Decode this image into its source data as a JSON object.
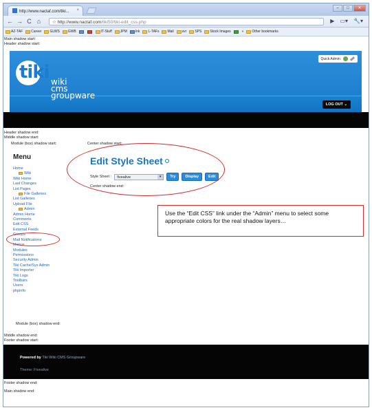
{
  "browser": {
    "tab_title": "http://www.nactaf.com/tiki...",
    "tab_close": "×",
    "window_controls": [
      "–",
      "□",
      "✕"
    ],
    "url_host": "http://www.nactaf.com",
    "url_path": "/tiki50/tiki-edit_css.php",
    "bookmarks": [
      {
        "label": "AZ-TAF",
        "icon": "folder"
      },
      {
        "label": "Career",
        "icon": "folder"
      },
      {
        "label": "GLWS",
        "icon": "folder"
      },
      {
        "label": "GWB",
        "icon": "folder"
      },
      {
        "label": "",
        "icon": "app"
      },
      {
        "label": "",
        "icon": "gmail"
      },
      {
        "label": "IT-Stuff",
        "icon": "folder"
      },
      {
        "label": "JPM",
        "icon": "folder"
      },
      {
        "label": "Ink",
        "icon": "app"
      },
      {
        "label": "L-TAFs",
        "icon": "folder"
      },
      {
        "label": "Mail",
        "icon": "folder"
      },
      {
        "label": "svr",
        "icon": "folder"
      },
      {
        "label": "SPS",
        "icon": "folder"
      },
      {
        "label": "Stock Images",
        "icon": "folder"
      },
      {
        "label": "",
        "icon": "green"
      },
      {
        "label": "»",
        "icon": ""
      },
      {
        "label": "Other bookmarks",
        "icon": "folder"
      }
    ]
  },
  "debug": {
    "main_start": "Main shadow start:",
    "header_start": "Header shadow start:",
    "header_end": "Header shadow end:",
    "middle_start": "Middle shadow start:",
    "module_start": "Module (box) shadow start:",
    "center_start": "Center shadow start:",
    "center_end": "Center shadow end:",
    "module_end": "Module (box) shadow end:",
    "middle_end": "Middle shadow end:",
    "footer_start": "Footer shadow start:",
    "footer_end": "Footer shadow end:",
    "main_end": "Main shadow end:"
  },
  "header": {
    "logo_main": "tiki",
    "logo_words": [
      "wiki",
      "cms",
      "groupware"
    ],
    "quick_admin": "Quick Admin:",
    "logout": "LOG OUT"
  },
  "menu": {
    "title": "Menu",
    "items": [
      {
        "label": "Home",
        "sub": false
      },
      {
        "label": "Wiki",
        "sub": true
      },
      {
        "label": "Wiki Home",
        "sub": false
      },
      {
        "label": "Last Changes",
        "sub": false
      },
      {
        "label": "List Pages",
        "sub": false
      },
      {
        "label": "File Galleries",
        "sub": true
      },
      {
        "label": "List Galleries",
        "sub": false
      },
      {
        "label": "Upload File",
        "sub": false
      },
      {
        "label": "Admin",
        "sub": true
      },
      {
        "label": "Admin Home",
        "sub": false
      },
      {
        "label": "Comments",
        "sub": false
      },
      {
        "label": "Edit CSS",
        "sub": false
      },
      {
        "label": "External Feeds",
        "sub": false
      },
      {
        "label": "Groups",
        "sub": false
      },
      {
        "label": "Mail Notifications",
        "sub": false
      },
      {
        "label": "Menus",
        "sub": false
      },
      {
        "label": "Modules",
        "sub": false
      },
      {
        "label": "Permissions",
        "sub": false
      },
      {
        "label": "Security Admin",
        "sub": false
      },
      {
        "label": "Tiki Cache/Sys Admin",
        "sub": false
      },
      {
        "label": "Tiki Importer",
        "sub": false
      },
      {
        "label": "Tiki Logs",
        "sub": false
      },
      {
        "label": "Toolbars",
        "sub": false
      },
      {
        "label": "Users",
        "sub": false
      },
      {
        "label": "phpinfo",
        "sub": false
      }
    ]
  },
  "edit_css": {
    "title": "Edit Style Sheet",
    "stylesheet_label": "Style Sheet :",
    "stylesheet_value": "fivealive",
    "buttons": [
      "Try",
      "Display",
      "Edit"
    ]
  },
  "callout": {
    "text": "Use the “Edit CSS” link under the “Admin” menu to select some appropriate colors for the real shadow layers…"
  },
  "footer": {
    "powered_by": "Powered by",
    "powered_name": "Tiki Wiki CMS Groupware",
    "theme": "Theme: Fivealive"
  },
  "colors": {
    "tiki_blue": "#1e74c4",
    "annotation_red": "#d42a2a",
    "link_blue": "#2264b8"
  }
}
